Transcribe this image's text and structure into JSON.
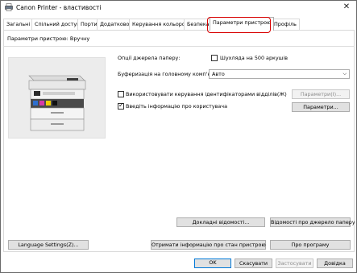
{
  "window": {
    "title": "Canon Printer - властивості"
  },
  "tabs": [
    {
      "label": "Загальні"
    },
    {
      "label": "Спільний доступ"
    },
    {
      "label": "Порти"
    },
    {
      "label": "Додатково"
    },
    {
      "label": "Керування кольором"
    },
    {
      "label": "Безпека"
    },
    {
      "label": "Параметри пристрою"
    },
    {
      "label": "Профіль"
    }
  ],
  "settings": {
    "hint": "Параметри пристрою: Вручну",
    "paper_source_label": "Опції джерела паперу:",
    "drawer_500_label": "Шухляда на 500 аркушів",
    "spooling_label": "Буферизація на головному комп'ютері:",
    "spooling_value": "Авто",
    "dept_id_label": "Використовувати керування ідентифікаторами відділів(Ж)",
    "dept_settings_label": "Параметри(І)...",
    "user_info_label": "Введіть інформацію про користувача",
    "user_settings_label": "Параметри..."
  },
  "buttons": {
    "details": "Докладні відомості...",
    "paper_source_info": "Відомості про джерело паперу",
    "language_settings": "Language Settings(Z)...",
    "get_device_status": "Отримати інформацію про стан пристрою",
    "about": "Про програму",
    "ok": "OK",
    "cancel": "Скасувати",
    "apply": "Застосувати",
    "help": "Довідка"
  }
}
